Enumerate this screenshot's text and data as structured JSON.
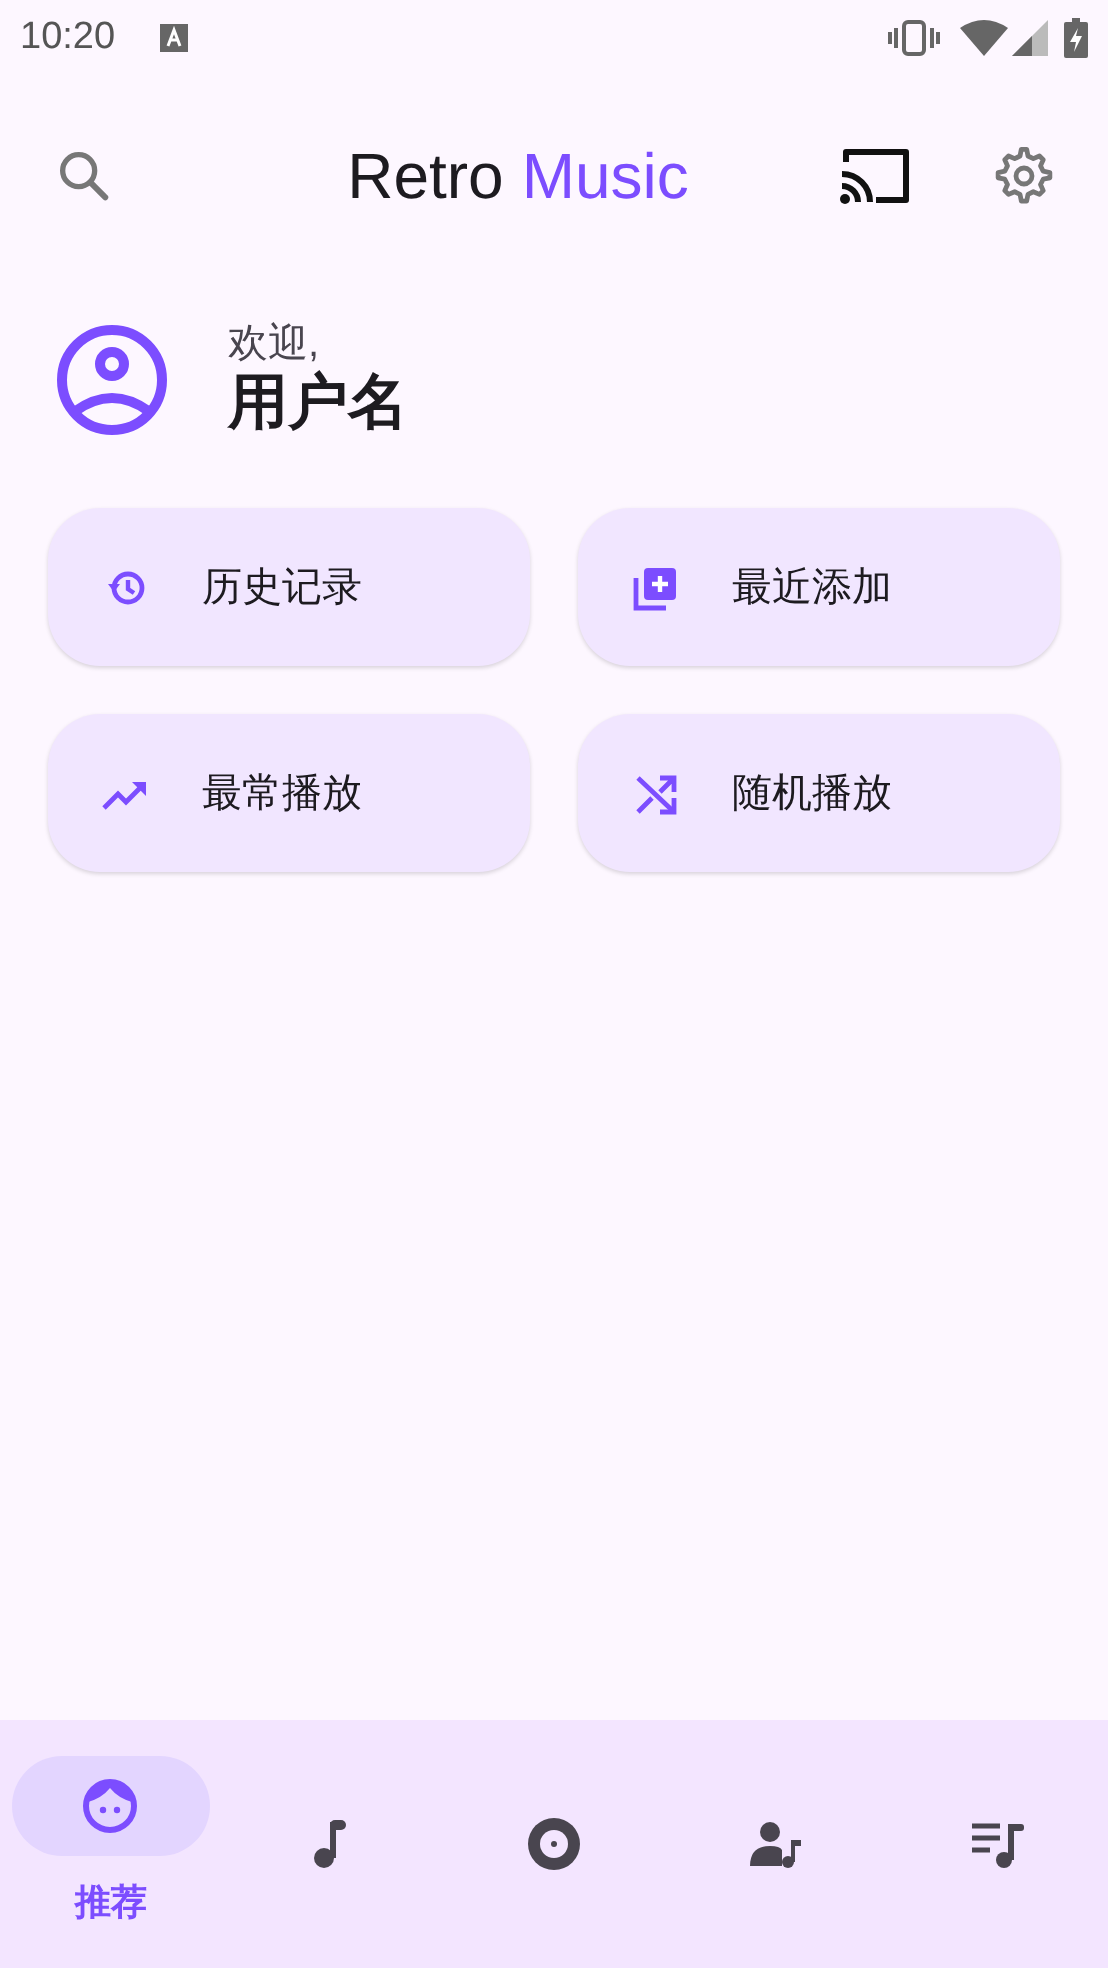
{
  "status_bar": {
    "time": "10:20"
  },
  "app_bar": {
    "title": "Retro",
    "title_accent": "Music"
  },
  "profile": {
    "greeting": "欢迎,",
    "username": "用户名"
  },
  "shortcuts": [
    {
      "kind": "history",
      "label": "历史记录"
    },
    {
      "kind": "recent",
      "label": "最近添加"
    },
    {
      "kind": "top",
      "label": "最常播放"
    },
    {
      "kind": "shuffle",
      "label": "随机播放"
    }
  ],
  "bottom_nav": [
    {
      "kind": "for_you",
      "label": "推荐",
      "selected": true
    },
    {
      "kind": "songs",
      "selected": false
    },
    {
      "kind": "albums",
      "selected": false
    },
    {
      "kind": "artists",
      "selected": false
    },
    {
      "kind": "playlists",
      "selected": false
    }
  ]
}
